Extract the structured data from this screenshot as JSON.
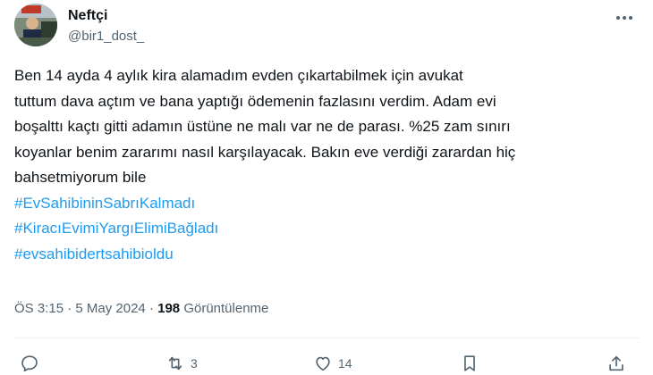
{
  "author": {
    "display_name": "Neftçi",
    "handle": "@bir1_dost_"
  },
  "tweet": {
    "lines": [
      "Ben 14 ayda 4 aylık kira alamadım evden çıkartabilmek için avukat",
      "tuttum dava açtım ve bana yaptığı ödemenin fazlasını verdim. Adam evi",
      "boşalttı kaçtı gitti adamın üstüne ne malı var ne de parası. %25 zam sınırı",
      "koyanlar benim zararımı nasıl karşılayacak. Bakın eve verdiği zarardan hiç",
      "bahsetmiyorum bile"
    ],
    "hashtags": [
      "#EvSahibininSabrıKalmadı",
      "#KiracıEvimiYargıElimiBağladı",
      "#evsahibidertsahibioldu"
    ]
  },
  "meta": {
    "time": "ÖS 3:15",
    "separator": " · ",
    "date": "5 May 2024",
    "views_count": "198",
    "views_label": " Görüntülenme"
  },
  "actions": {
    "replies": "",
    "retweets": "3",
    "likes": "14"
  },
  "icons": {
    "more": "more-dots-icon",
    "reply": "reply-icon",
    "retweet": "retweet-icon",
    "like": "heart-icon",
    "bookmark": "bookmark-icon",
    "share": "share-icon"
  },
  "colors": {
    "text": "#0f1419",
    "secondary": "#536471",
    "link": "#1d9bf0"
  }
}
